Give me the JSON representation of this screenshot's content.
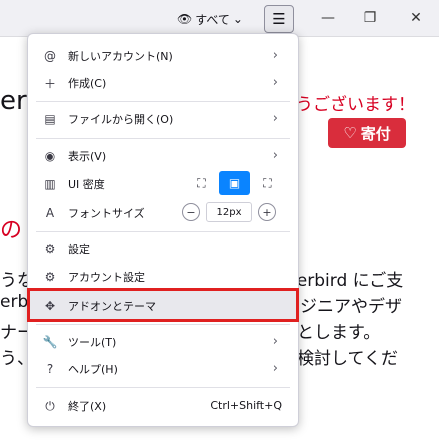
{
  "titlebar": {
    "filter_label": "すべて",
    "menu_icon": "☰"
  },
  "background": {
    "fragment_title": "erb",
    "fragment_thanks": "うございます！",
    "donate_label": "寄付",
    "fragment_heading": "の",
    "fragment_line1_left": "うな",
    "fragment_line1_right": "derbird にご支",
    "fragment_line2_left": "erbi",
    "fragment_line2_right": "ジニアやデザ",
    "fragment_line3_left": "ナー",
    "fragment_line3_right": "とします。",
    "fragment_line4_left": "う、",
    "fragment_line4_right": "検討してくだ"
  },
  "menu": {
    "new_account": "新しいアカウント(N)",
    "create": "作成(C)",
    "open_file": "ファイルから開く(O)",
    "view": "表示(V)",
    "ui_density": "UI 密度",
    "font_size": "フォントサイズ",
    "font_size_value": "12px",
    "settings": "設定",
    "account_settings": "アカウント設定",
    "addons_themes": "アドオンとテーマ",
    "tools": "ツール(T)",
    "help": "ヘルプ(H)",
    "quit": "終了(X)",
    "quit_shortcut": "Ctrl+Shift+Q"
  },
  "colors": {
    "accent": "#0a84ff",
    "highlight_border": "#e02020",
    "donate_bg": "#d92d3c"
  }
}
